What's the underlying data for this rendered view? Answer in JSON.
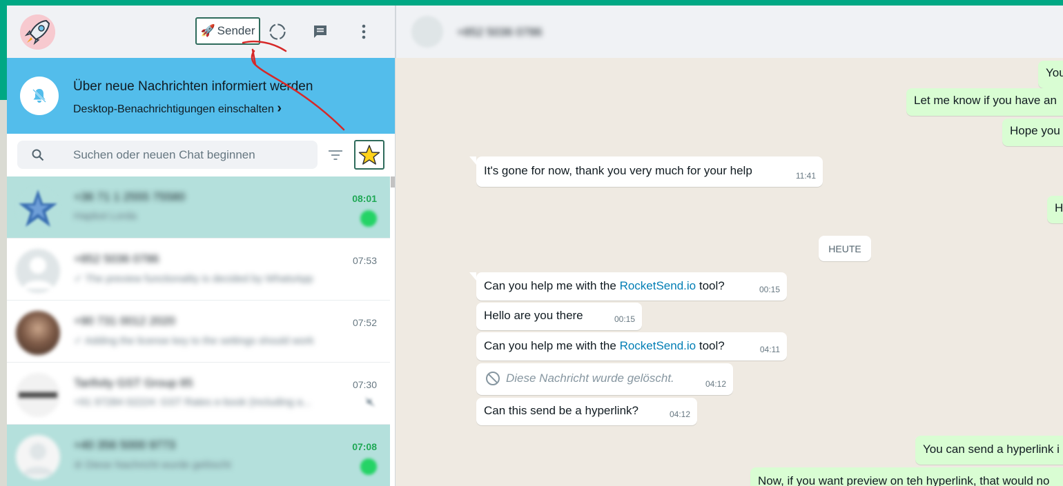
{
  "header": {
    "sender_label": "Sender",
    "sender_emoji": "🚀"
  },
  "notification": {
    "title": "Über neue Nachrichten informiert werden",
    "subtitle": "Desktop-Benachrichtigungen einschalten",
    "chevron": "›"
  },
  "search": {
    "placeholder": "Suchen oder neuen Chat beginnen"
  },
  "chats": [
    {
      "name": "+36 71 1 2555 75580",
      "preview": "Hapbot Lorda",
      "time": "08:01",
      "unread": true,
      "avatar_color": "#3a6fb3"
    },
    {
      "name": "+852 5036 0786",
      "preview": "✓ The preview functionality is decided by WhatsApp",
      "time": "07:53",
      "unread": false,
      "avatar_color": "#dfe5e7"
    },
    {
      "name": "+90 731 0012 2020",
      "preview": "✓ Adding the license key to the settings should work",
      "time": "07:52",
      "unread": false,
      "avatar_color": "#6b5044"
    },
    {
      "name": "Tarifxity GST Group 85",
      "preview": "+91 97284 02224: GST Rates e-book (Including a...",
      "time": "07:30",
      "unread": false,
      "muted": true,
      "avatar_color": "#eeeeee"
    },
    {
      "name": "+40 356 5000 9773",
      "preview": "⊘ Diese Nachricht wurde gelöscht",
      "time": "07:08",
      "unread": true,
      "avatar_color": "#f5f5f5"
    }
  ],
  "conversation": {
    "contact_name": "+852 5036 0786",
    "date_divider": "HEUTE",
    "messages": [
      {
        "dir": "out",
        "text": "You"
      },
      {
        "dir": "out",
        "text": "Let me know if you have an"
      },
      {
        "dir": "out",
        "text": "Hope you"
      },
      {
        "dir": "in",
        "text": "It's gone for now, thank you very much for your help",
        "time": "11:41"
      },
      {
        "dir": "out",
        "text": "H"
      },
      {
        "dir": "in",
        "text_before": "Can you help me with the ",
        "link": "RocketSend.io",
        "text_after": " tool?",
        "time": "00:15"
      },
      {
        "dir": "in",
        "text": "Hello are you there",
        "time": "00:15"
      },
      {
        "dir": "in",
        "text_before": "Can you help me with the ",
        "link": "RocketSend.io",
        "text_after": " tool?",
        "time": "04:11"
      },
      {
        "dir": "in",
        "text": "Diese Nachricht wurde gelöscht.",
        "time": "04:12",
        "deleted": true
      },
      {
        "dir": "in",
        "text": "Can this send be a hyperlink?",
        "time": "04:12"
      },
      {
        "dir": "out",
        "text": "You can send a hyperlink i"
      },
      {
        "dir": "out",
        "text": "Now, if you want preview on teh hyperlink, that would no"
      }
    ]
  },
  "colors": {
    "accent": "#00a884",
    "banner": "#53bdeb",
    "highlight_row": "#b4e0dc",
    "outgoing_bubble": "#d9fdd3",
    "link": "#027eb5",
    "annotation": "#d62828"
  }
}
